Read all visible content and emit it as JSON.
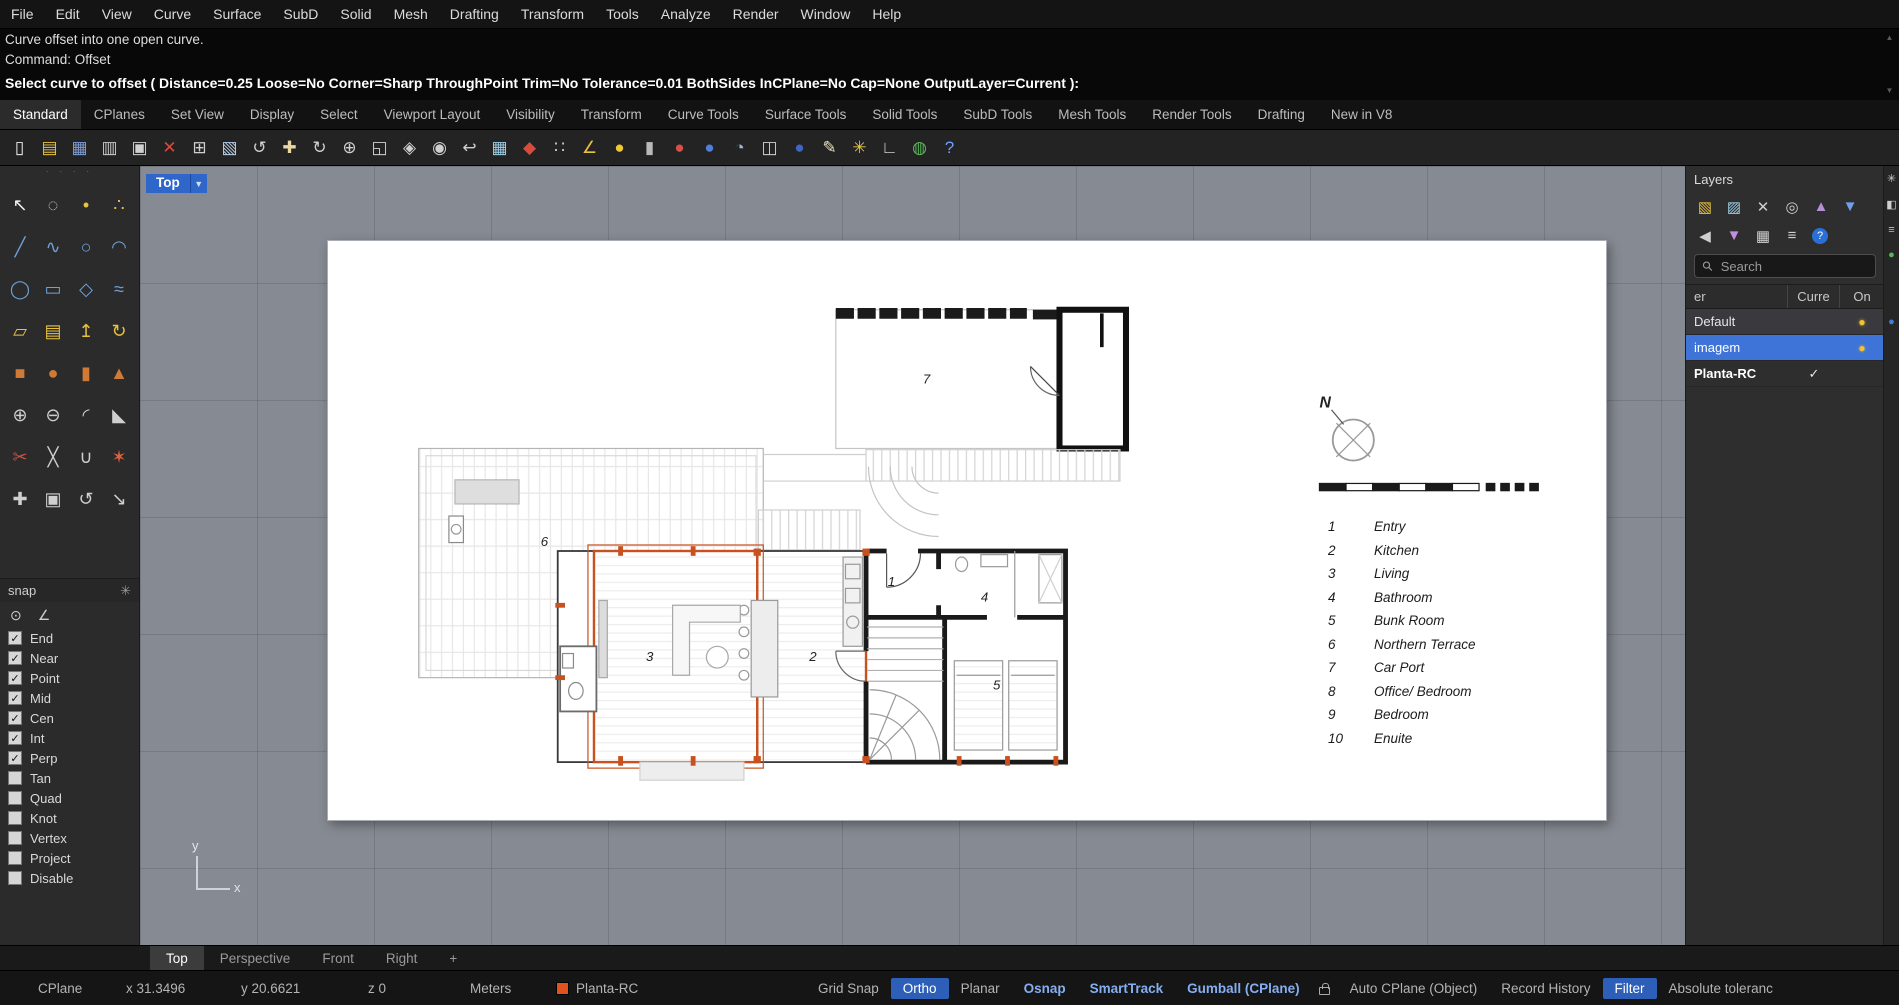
{
  "menu": {
    "items": [
      "File",
      "Edit",
      "View",
      "Curve",
      "Surface",
      "SubD",
      "Solid",
      "Mesh",
      "Drafting",
      "Transform",
      "Tools",
      "Analyze",
      "Render",
      "Window",
      "Help"
    ]
  },
  "command": {
    "history_1": "Curve offset into one open curve.",
    "history_2": "Command: Offset",
    "prompt": "Select curve to offset ( Distance=0.25  Loose=No  Corner=Sharp  ThroughPoint  Trim=No  Tolerance=0.01  BothSides  InCPlane=No  Cap=None  OutputLayer=Current ):"
  },
  "group_tabs": [
    {
      "label": "Standard",
      "n": "tab-standard",
      "active": true
    },
    {
      "label": "CPlanes",
      "n": "tab-cplanes"
    },
    {
      "label": "Set View",
      "n": "tab-set-view"
    },
    {
      "label": "Display",
      "n": "tab-display"
    },
    {
      "label": "Select",
      "n": "tab-select"
    },
    {
      "label": "Viewport Layout",
      "n": "tab-viewport-layout"
    },
    {
      "label": "Visibility",
      "n": "tab-visibility"
    },
    {
      "label": "Transform",
      "n": "tab-transform"
    },
    {
      "label": "Curve Tools",
      "n": "tab-curve-tools"
    },
    {
      "label": "Surface Tools",
      "n": "tab-surface-tools"
    },
    {
      "label": "Solid Tools",
      "n": "tab-solid-tools"
    },
    {
      "label": "SubD Tools",
      "n": "tab-subd-tools"
    },
    {
      "label": "Mesh Tools",
      "n": "tab-mesh-tools"
    },
    {
      "label": "Render Tools",
      "n": "tab-render-tools"
    },
    {
      "label": "Drafting",
      "n": "tab-drafting"
    },
    {
      "label": "New in V8",
      "n": "tab-new-in-v8"
    }
  ],
  "toolbar": {
    "icons": [
      {
        "n": "new-file-icon",
        "g": "▯",
        "c": "#f0f0f0"
      },
      {
        "n": "open-file-icon",
        "g": "▤",
        "c": "#e8c23f"
      },
      {
        "n": "save-icon",
        "g": "▦",
        "c": "#7f9fd8"
      },
      {
        "n": "print-icon",
        "g": "▥",
        "c": "#c9c9c9"
      },
      {
        "n": "copy-to-clipboard-icon",
        "g": "▣",
        "c": "#cfcfcf"
      },
      {
        "n": "delete-icon",
        "g": "✕",
        "c": "#d84a3a"
      },
      {
        "n": "copy-icon",
        "g": "⊞",
        "c": "#cfcfcf"
      },
      {
        "n": "paste-icon",
        "g": "▧",
        "c": "#b8cfe8"
      },
      {
        "n": "undo-icon",
        "g": "↺",
        "c": "#cfcfcf"
      },
      {
        "n": "pan-icon",
        "g": "✚",
        "c": "#e8d8a0"
      },
      {
        "n": "rotate-view-icon",
        "g": "↻",
        "c": "#cfcfcf"
      },
      {
        "n": "zoom-dynamic-icon",
        "g": "⊕",
        "c": "#cfcfcf"
      },
      {
        "n": "zoom-window-icon",
        "g": "◱",
        "c": "#cfcfcf"
      },
      {
        "n": "zoom-extents-icon",
        "g": "◈",
        "c": "#cfcfcf"
      },
      {
        "n": "zoom-selected-icon",
        "g": "◉",
        "c": "#cfcfcf"
      },
      {
        "n": "undo-view-icon",
        "g": "↩",
        "c": "#cfcfcf"
      },
      {
        "n": "viewport-layout-icon",
        "g": "▦",
        "c": "#9fd0e8"
      },
      {
        "n": "named-view-icon",
        "g": "◆",
        "c": "#d84a3a"
      },
      {
        "n": "array-icon",
        "g": "∷",
        "c": "#cfcfcf"
      },
      {
        "n": "orient-icon",
        "g": "∠",
        "c": "#e8c23f"
      },
      {
        "n": "hide-show-lightbulb-icon",
        "g": "●",
        "c": "#f0c830"
      },
      {
        "n": "lock-objects-icon",
        "g": "▮",
        "c": "#b9b9b9"
      },
      {
        "n": "shaded-display-icon",
        "g": "●",
        "c": "#d85045"
      },
      {
        "n": "rendered-display-icon",
        "g": "●",
        "c": "#4f7fd8"
      },
      {
        "n": "ghosted-display-icon",
        "g": "◔",
        "c": "#9fb8d8"
      },
      {
        "n": "selection-window-icon",
        "g": "◫",
        "c": "#cfcfcf"
      },
      {
        "n": "render-preview-icon",
        "g": "●",
        "c": "#3f64c8"
      },
      {
        "n": "annotate-pen-icon",
        "g": "✎",
        "c": "#e8e0c0"
      },
      {
        "n": "options-gear-icon",
        "g": "✳",
        "c": "#e8c23f"
      },
      {
        "n": "cplane-widget-icon",
        "g": "∟",
        "c": "#cfcfcf"
      },
      {
        "n": "earth-icon",
        "g": "◍",
        "c": "#58b858"
      },
      {
        "n": "help-icon",
        "g": "?",
        "c": "#6fa0ff"
      }
    ]
  },
  "palette": {
    "icons": [
      {
        "n": "select-arrow-icon",
        "g": "↖",
        "c": "#f0f0f0"
      },
      {
        "n": "selection-brush-icon",
        "g": "◌",
        "c": "#cfcfcf"
      },
      {
        "n": "point-icon",
        "g": "•",
        "c": "#e8c23f"
      },
      {
        "n": "pointcloud-icon",
        "g": "∴",
        "c": "#e8c23f"
      },
      {
        "n": "polyline-icon",
        "g": "╱",
        "c": "#6fa0d8"
      },
      {
        "n": "freeform-curve-icon",
        "g": "∿",
        "c": "#6fa0d8"
      },
      {
        "n": "circle-icon",
        "g": "○",
        "c": "#6fa0d8"
      },
      {
        "n": "arc-icon",
        "g": "◠",
        "c": "#6fa0d8"
      },
      {
        "n": "ellipse-icon",
        "g": "◯",
        "c": "#6fa0d8"
      },
      {
        "n": "rectangle-icon",
        "g": "▭",
        "c": "#6fa0d8"
      },
      {
        "n": "polygon-icon",
        "g": "◇",
        "c": "#6fa0d8"
      },
      {
        "n": "helix-icon",
        "g": "≈",
        "c": "#6fa0d8"
      },
      {
        "n": "surface-plane-icon",
        "g": "▱",
        "c": "#e8c23f"
      },
      {
        "n": "loft-icon",
        "g": "▤",
        "c": "#e8c23f"
      },
      {
        "n": "extrude-icon",
        "g": "↥",
        "c": "#e8c23f"
      },
      {
        "n": "revolve-icon",
        "g": "↻",
        "c": "#e8c23f"
      },
      {
        "n": "box-icon",
        "g": "■",
        "c": "#d07a35"
      },
      {
        "n": "sphere-icon",
        "g": "●",
        "c": "#d07a35"
      },
      {
        "n": "cylinder-icon",
        "g": "▮",
        "c": "#d07a35"
      },
      {
        "n": "cone-icon",
        "g": "▲",
        "c": "#d07a35"
      },
      {
        "n": "boolean-union-icon",
        "g": "⊕",
        "c": "#cfcfcf"
      },
      {
        "n": "boolean-difference-icon",
        "g": "⊖",
        "c": "#cfcfcf"
      },
      {
        "n": "fillet-icon",
        "g": "◜",
        "c": "#cfcfcf"
      },
      {
        "n": "chamfer-icon",
        "g": "◣",
        "c": "#cfcfcf"
      },
      {
        "n": "trim-icon",
        "g": "✂",
        "c": "#d05045"
      },
      {
        "n": "split-icon",
        "g": "╳",
        "c": "#cfcfcf"
      },
      {
        "n": "join-icon",
        "g": "∪",
        "c": "#cfcfcf"
      },
      {
        "n": "explode-icon",
        "g": "✶",
        "c": "#e06040"
      },
      {
        "n": "move-icon",
        "g": "✚",
        "c": "#cfcfcf"
      },
      {
        "n": "copy-object-icon",
        "g": "▣",
        "c": "#cfcfcf"
      },
      {
        "n": "rotate-icon",
        "g": "↺",
        "c": "#cfcfcf"
      },
      {
        "n": "scale-icon",
        "g": "↘",
        "c": "#cfcfcf"
      }
    ]
  },
  "osnap": {
    "title": "snap",
    "sub_icons": [
      {
        "n": "project-osnap-icon",
        "g": "⊙",
        "c": "#cfcfcf"
      },
      {
        "n": "smarttrack-osnap-icon",
        "g": "∠",
        "c": "#cfcfcf"
      }
    ],
    "items": [
      {
        "label": "End",
        "checked": true
      },
      {
        "label": "Near",
        "checked": true
      },
      {
        "label": "Point",
        "checked": true
      },
      {
        "label": "Mid",
        "checked": true
      },
      {
        "label": "Cen",
        "checked": true
      },
      {
        "label": "Int",
        "checked": true
      },
      {
        "label": "Perp",
        "checked": true
      },
      {
        "label": "Tan",
        "checked": false
      },
      {
        "label": "Quad",
        "checked": false
      },
      {
        "label": "Knot",
        "checked": false
      },
      {
        "label": "Vertex",
        "checked": false
      },
      {
        "label": "Project",
        "checked": false
      },
      {
        "label": "Disable",
        "checked": false
      }
    ]
  },
  "viewport": {
    "label": "Top",
    "axis_x": "x",
    "axis_y": "y"
  },
  "plan": {
    "room_labels": [
      "1",
      "2",
      "3",
      "4",
      "5",
      "6",
      "7"
    ],
    "north_label": "N",
    "legend": [
      {
        "num": "1",
        "label": "Entry"
      },
      {
        "num": "2",
        "label": "Kitchen"
      },
      {
        "num": "3",
        "label": "Living"
      },
      {
        "num": "4",
        "label": "Bathroom"
      },
      {
        "num": "5",
        "label": "Bunk Room"
      },
      {
        "num": "6",
        "label": "Northern Terrace"
      },
      {
        "num": "7",
        "label": "Car Port"
      },
      {
        "num": "8",
        "label": "Office/ Bedroom"
      },
      {
        "num": "9",
        "label": "Bedroom"
      },
      {
        "num": "10",
        "label": "Enuite"
      }
    ]
  },
  "layers_panel": {
    "title": "Layers",
    "search_placeholder": "Search",
    "columns": [
      "er",
      "Curre",
      "On"
    ],
    "toolbar1": [
      {
        "n": "new-layer-icon",
        "g": "▧",
        "c": "#e8c23f"
      },
      {
        "n": "new-sublayer-icon",
        "g": "▨",
        "c": "#9fd0e8"
      },
      {
        "n": "delete-layer-icon",
        "g": "✕",
        "c": "#cfcfcf"
      },
      {
        "n": "match-layer-icon",
        "g": "◎",
        "c": "#cfcfcf"
      },
      {
        "n": "move-layer-up-icon",
        "g": "▲",
        "c": "#b88fd6"
      },
      {
        "n": "move-layer-down-icon",
        "g": "▼",
        "c": "#6f9fe8"
      }
    ],
    "toolbar2": [
      {
        "n": "collapse-panel-icon",
        "g": "◀",
        "c": "#cfcfcf"
      },
      {
        "n": "filter-layers-icon",
        "g": "▼",
        "c": "#c08fe0"
      },
      {
        "n": "layer-grid-view-icon",
        "g": "▦",
        "c": "#cfcfcf"
      },
      {
        "n": "layer-list-view-icon",
        "g": "≡",
        "c": "#cfcfcf"
      }
    ],
    "help_label": "?",
    "strip_icons": [
      {
        "n": "panel-gear-icon",
        "g": "✳",
        "c": "#cfcfcf"
      },
      {
        "n": "properties-panel-tab-icon",
        "g": "◧",
        "c": "#cfcfcf"
      },
      {
        "n": "layers-panel-tab-icon",
        "g": "≡",
        "c": "#e8c23f"
      },
      {
        "n": "display-panel-tab-icon",
        "g": "●",
        "c": "#58b858"
      },
      {
        "n": "libraries-panel-tab-icon",
        "g": "●",
        "c": "#3f7fd8"
      }
    ],
    "rows": [
      {
        "name": "Default",
        "on": true,
        "shade": true
      },
      {
        "name": "imagem",
        "on": true,
        "selected": true
      },
      {
        "name": "Planta-RC",
        "current": true
      }
    ]
  },
  "viewport_tabs": [
    {
      "label": "Top",
      "n": "vp-tab-top",
      "active": true
    },
    {
      "label": "Perspective",
      "n": "vp-tab-perspective"
    },
    {
      "label": "Front",
      "n": "vp-tab-front"
    },
    {
      "label": "Right",
      "n": "vp-tab-right"
    },
    {
      "label": "+",
      "n": "vp-tab-add"
    }
  ],
  "status_bar": {
    "cplane_label": "CPlane",
    "coord_x": "x 31.3496",
    "coord_y": "y 20.6621",
    "coord_z": "z 0",
    "units": "Meters",
    "active_layer": "Planta-RC",
    "layer_color": "#e0531f",
    "buttons_left": [
      {
        "label": "Grid Snap",
        "n": "grid-snap-button"
      },
      {
        "label": "Ortho",
        "n": "ortho-button",
        "bg": true
      },
      {
        "label": "Planar",
        "n": "planar-button"
      },
      {
        "label": "Osnap",
        "n": "osnap-button",
        "hl": true
      },
      {
        "label": "SmartTrack",
        "n": "smarttrack-button",
        "hl": true
      },
      {
        "label": "Gumball (CPlane)",
        "n": "gumball-button",
        "hl": true
      }
    ],
    "buttons_right": [
      {
        "label": "Auto CPlane (Object)",
        "n": "auto-cplane-button"
      },
      {
        "label": "Record History",
        "n": "record-history-button"
      },
      {
        "label": "Filter",
        "n": "filter-button",
        "bg": true
      },
      {
        "label": "Absolute toleranc",
        "n": "absolute-tolerance-button"
      }
    ]
  }
}
